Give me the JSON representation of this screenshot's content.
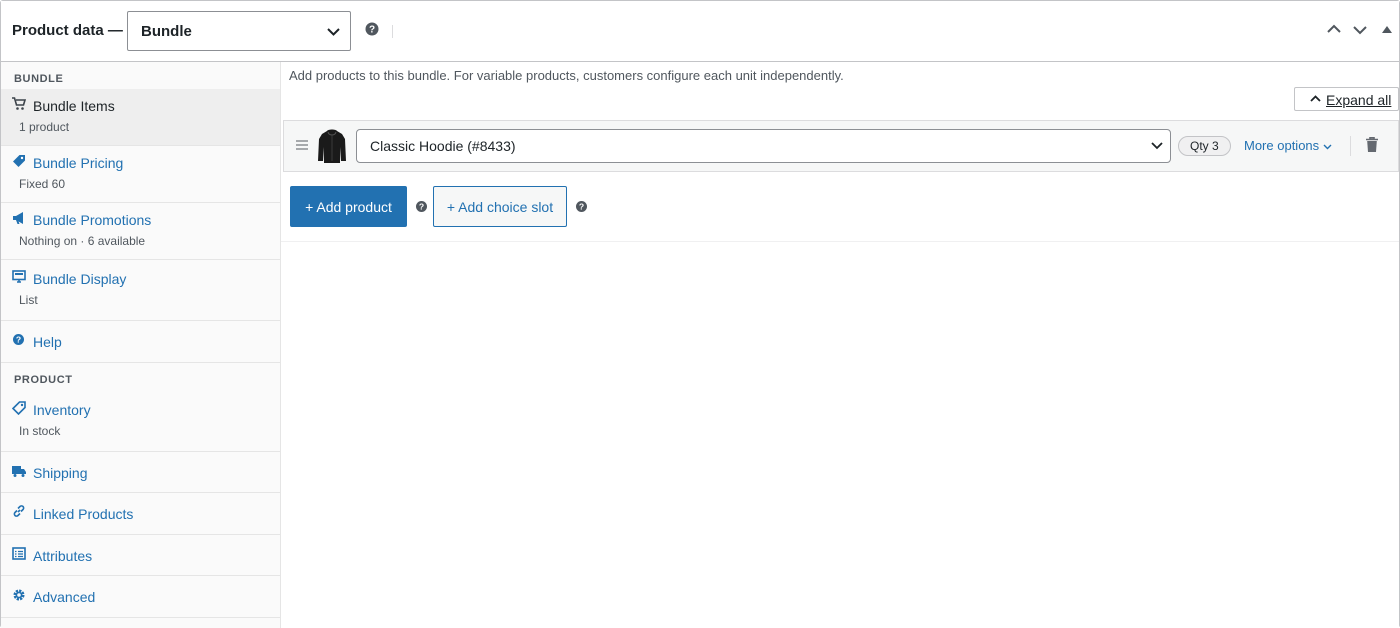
{
  "header": {
    "title": "Product data —",
    "product_type": "Bundle"
  },
  "sidebar": {
    "section_bundle": "BUNDLE",
    "section_product": "PRODUCT",
    "items": [
      {
        "label": "Bundle Items",
        "sub": "1 product",
        "icon": "cart-icon",
        "active": true
      },
      {
        "label": "Bundle Pricing",
        "sub": "Fixed 60",
        "icon": "tag-icon"
      },
      {
        "label": "Bundle Promotions",
        "sub": "Nothing on · 6 available",
        "icon": "megaphone-icon"
      },
      {
        "label": "Bundle Display",
        "sub": "List",
        "icon": "monitor-icon"
      },
      {
        "label": "Help",
        "sub": "",
        "icon": "help-icon"
      },
      {
        "label": "Inventory",
        "sub": "In stock",
        "icon": "inventory-tag-icon"
      },
      {
        "label": "Shipping",
        "sub": "",
        "icon": "truck-icon"
      },
      {
        "label": "Linked Products",
        "sub": "",
        "icon": "link-icon"
      },
      {
        "label": "Attributes",
        "sub": "",
        "icon": "list-icon"
      },
      {
        "label": "Advanced",
        "sub": "",
        "icon": "gear-icon"
      }
    ]
  },
  "main": {
    "intro": "Add products to this bundle. For variable products, customers configure each unit independently.",
    "expand_all": "Expand all",
    "bundle_item": {
      "product": "Classic Hoodie (#8433)",
      "qty": "Qty 3",
      "more_options": "More options"
    },
    "add_product": "+ Add product",
    "add_choice_slot": "+ Add choice slot"
  },
  "colors": {
    "accent": "#2271b1",
    "text": "#1d2327",
    "muted": "#50575e",
    "border": "#c3c4c7"
  }
}
